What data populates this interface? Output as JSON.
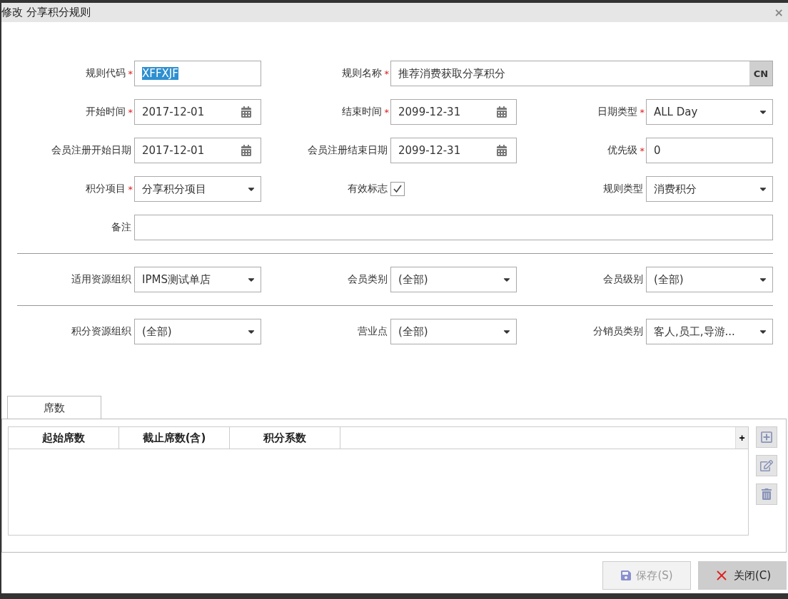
{
  "window": {
    "title": "修改 分享积分规则",
    "close": "×"
  },
  "form_rows": [
    [
      {
        "label": "规则代码",
        "mark": "*",
        "kind": "text",
        "value": "XFFXJF",
        "highlighted": true
      },
      {
        "label": "规则名称",
        "mark": "*",
        "kind": "lang",
        "value": "推荐消费获取分享积分",
        "lang": "CN"
      }
    ],
    [
      {
        "label": "开始时间",
        "mark": "*",
        "kind": "date",
        "value": "2017-12-01"
      },
      {
        "label": "结束时间",
        "mark": "*",
        "kind": "date",
        "value": "2099-12-31"
      },
      {
        "label": "日期类型",
        "mark": "*",
        "kind": "select",
        "value": "ALL Day"
      }
    ],
    [
      {
        "label": "会员注册开始日期",
        "kind": "date",
        "value": "2017-12-01"
      },
      {
        "label": "会员注册结束日期",
        "kind": "date",
        "value": "2099-12-31"
      },
      {
        "label": "优先级",
        "mark": "*",
        "kind": "text",
        "value": "0"
      }
    ],
    [
      {
        "label": "积分项目",
        "mark": "*",
        "kind": "select",
        "value": "分享积分项目"
      },
      {
        "label": "有效标志",
        "kind": "checkbox",
        "checked": true
      },
      {
        "label": "规则类型",
        "kind": "select",
        "value": "消费积分"
      }
    ],
    [
      {
        "label": "备注",
        "kind": "wide"
      }
    ]
  ],
  "filter_groups": [
    [
      {
        "label": "适用资源组织",
        "value": "IPMS测试单店"
      },
      {
        "label": "会员类别",
        "value": "(全部)"
      },
      {
        "label": "会员级别",
        "value": "(全部)"
      }
    ],
    [
      {
        "label": "积分资源组织",
        "value": "(全部)"
      },
      {
        "label": "营业点",
        "value": "(全部)"
      },
      {
        "label": "分销员类别",
        "value": "客人,员工,导游..."
      }
    ]
  ],
  "tabs": [
    {
      "label": "席数",
      "selected": true
    }
  ],
  "table": {
    "columns": [
      "起始席数",
      "截止席数(含)",
      "积分系数"
    ],
    "corner": "+"
  },
  "buttons": [
    {
      "label": "保存(S)",
      "kind": "save",
      "disabled": true
    },
    {
      "label": "关闭(C)",
      "kind": "close",
      "disabled": false
    }
  ]
}
